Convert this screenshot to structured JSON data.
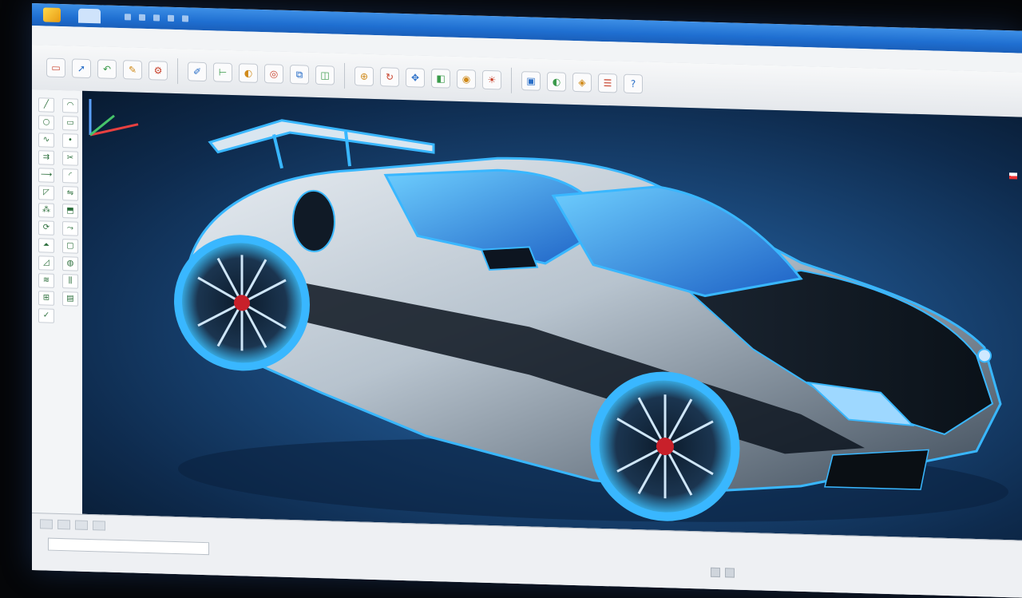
{
  "window": {
    "app_logo": "app-logo-icon",
    "title": "",
    "tab_label": ""
  },
  "menubar": {
    "items": []
  },
  "toolbar": {
    "icons": [
      "file-icon",
      "pointer-icon",
      "undo-icon",
      "sketch-icon",
      "gear-icon",
      "draw-icon",
      "measure-icon",
      "render-icon",
      "analyze-icon",
      "assembly-icon",
      "view-icon",
      "zoom-icon",
      "rotate-icon",
      "pan-icon",
      "section-icon",
      "color-icon",
      "light-icon",
      "camera-icon",
      "render-icon",
      "material-icon",
      "settings-icon",
      "help-icon"
    ]
  },
  "toolbox": {
    "icons": [
      "line-icon",
      "arc-icon",
      "circle-icon",
      "rect-icon",
      "spline-icon",
      "point-icon",
      "offset-icon",
      "trim-icon",
      "extend-icon",
      "fillet-icon",
      "chamfer-icon",
      "mirror-icon",
      "pattern-icon",
      "extrude-icon",
      "revolve-icon",
      "sweep-icon",
      "loft-icon",
      "shell-icon",
      "draft-icon",
      "hole-icon",
      "thread-icon",
      "split-icon",
      "join-icon",
      "surface-icon",
      "check-icon"
    ]
  },
  "viewport": {
    "model": "3d-sports-car-model",
    "background_colors": [
      "#2f6da8",
      "#0e2b4e"
    ],
    "accent": "#39b7ff"
  },
  "status": {
    "left_text": "",
    "coordinates": ""
  }
}
